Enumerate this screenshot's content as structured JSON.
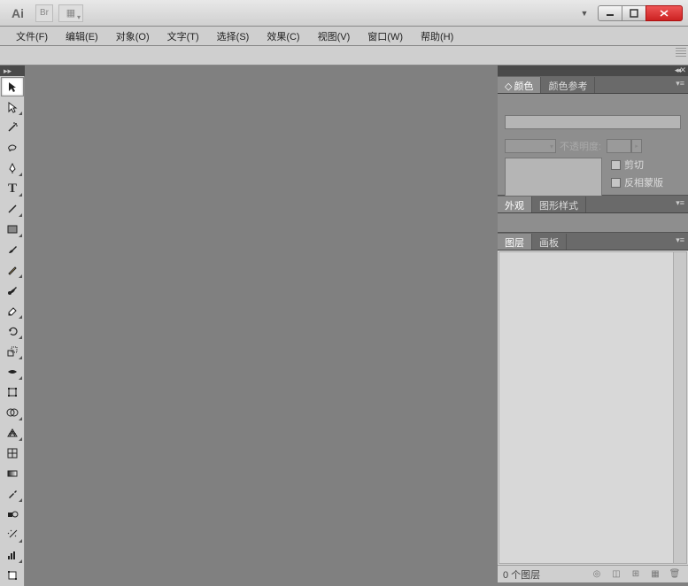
{
  "app": {
    "logo": "Ai"
  },
  "menu": {
    "file": "文件(F)",
    "edit": "编辑(E)",
    "object": "对象(O)",
    "type": "文字(T)",
    "select": "选择(S)",
    "effect": "效果(C)",
    "view": "视图(V)",
    "window": "窗口(W)",
    "help": "帮助(H)"
  },
  "panels": {
    "color": {
      "tab1": "颜色",
      "tab2": "颜色参考",
      "opacity_label": "不透明度:",
      "clip": "剪切",
      "invert": "反相蒙版"
    },
    "appearance": {
      "tab1": "外观",
      "tab2": "图形样式"
    },
    "layers": {
      "tab1": "图层",
      "tab2": "画板",
      "count": "0 个图层"
    }
  }
}
